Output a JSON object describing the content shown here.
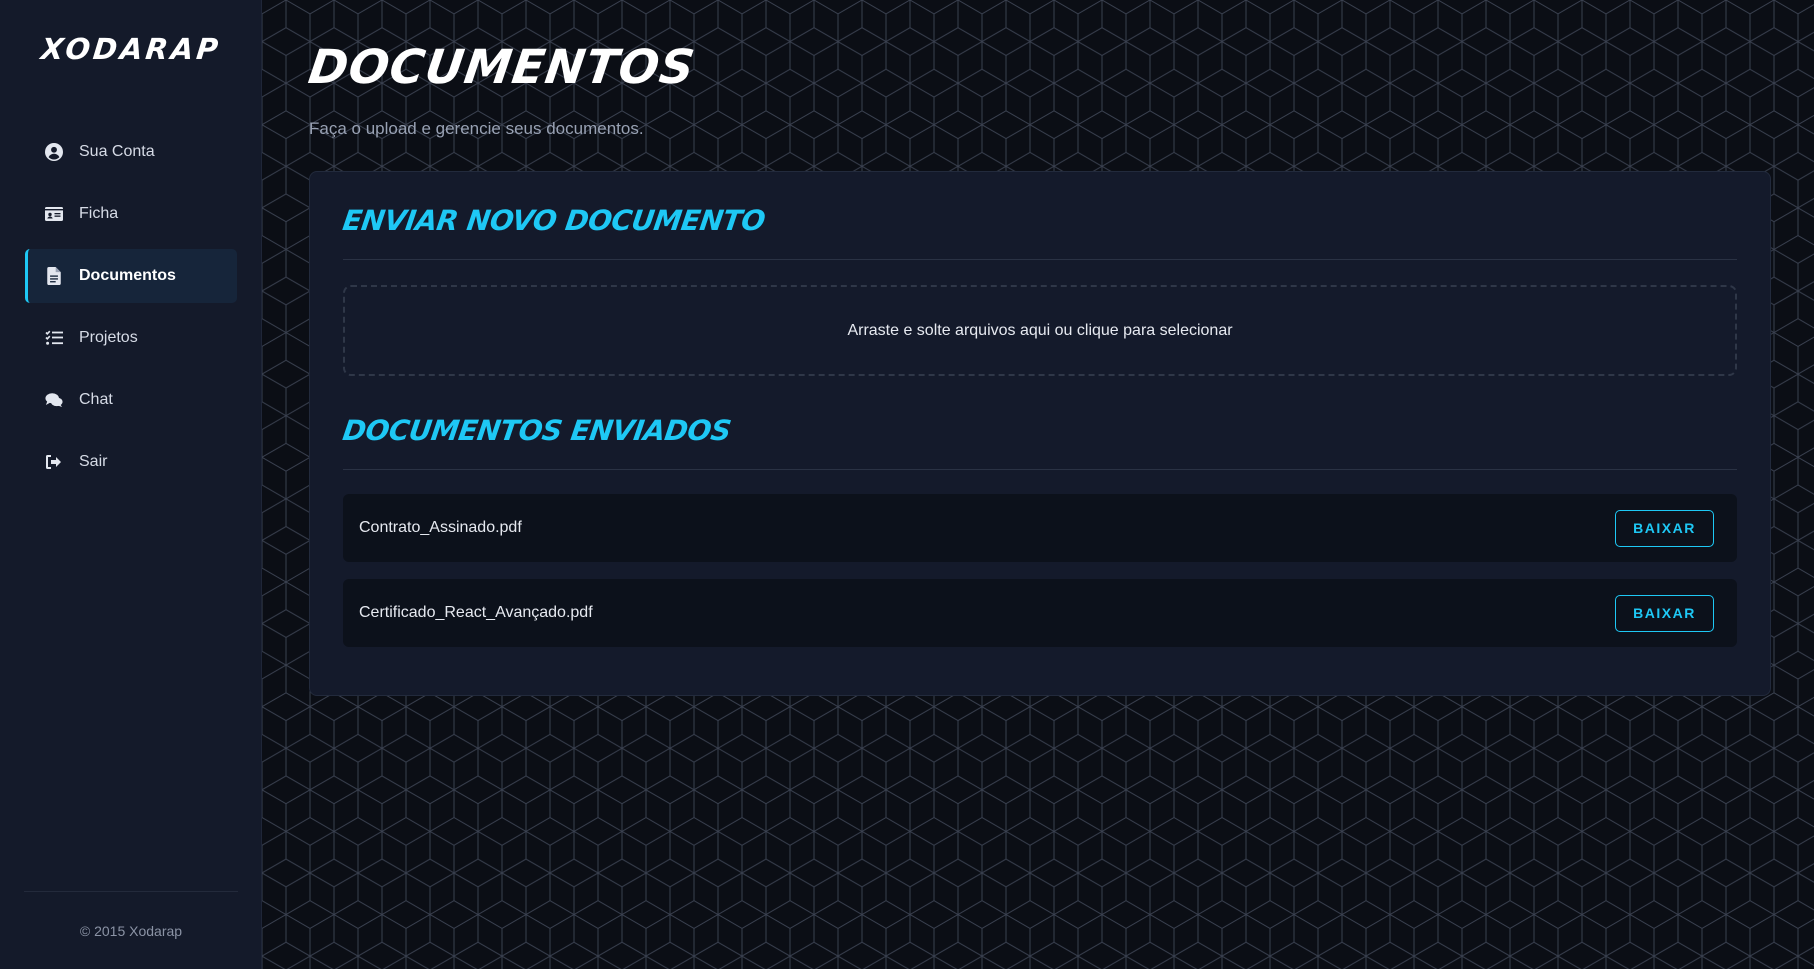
{
  "app": {
    "logo": "XODARAP"
  },
  "sidebar": {
    "items": [
      {
        "label": "Sua Conta",
        "icon": "user-circle-icon",
        "active": false
      },
      {
        "label": "Ficha",
        "icon": "id-card-icon",
        "active": false
      },
      {
        "label": "Documentos",
        "icon": "file-icon",
        "active": true
      },
      {
        "label": "Projetos",
        "icon": "task-list-icon",
        "active": false
      },
      {
        "label": "Chat",
        "icon": "chat-bubbles-icon",
        "active": false
      },
      {
        "label": "Sair",
        "icon": "sign-out-icon",
        "active": false
      }
    ],
    "footer": "© 2015 Xodarap"
  },
  "page": {
    "title": "DOCUMENTOS",
    "subtitle": "Faça o upload e gerencie seus documentos."
  },
  "upload": {
    "title": "ENVIAR NOVO DOCUMENTO",
    "dropzone_text": "Arraste e solte arquivos aqui ou clique para selecionar"
  },
  "documents": {
    "title": "DOCUMENTOS ENVIADOS",
    "items": [
      {
        "name": "Contrato_Assinado.pdf",
        "action": "BAIXAR"
      },
      {
        "name": "Certificado_React_Avançado.pdf",
        "action": "BAIXAR"
      }
    ]
  },
  "colors": {
    "accent": "#1ec8f5",
    "sidebar_bg": "#141a2a",
    "page_bg": "#0b0e15",
    "card_bg": "#141a2b"
  }
}
